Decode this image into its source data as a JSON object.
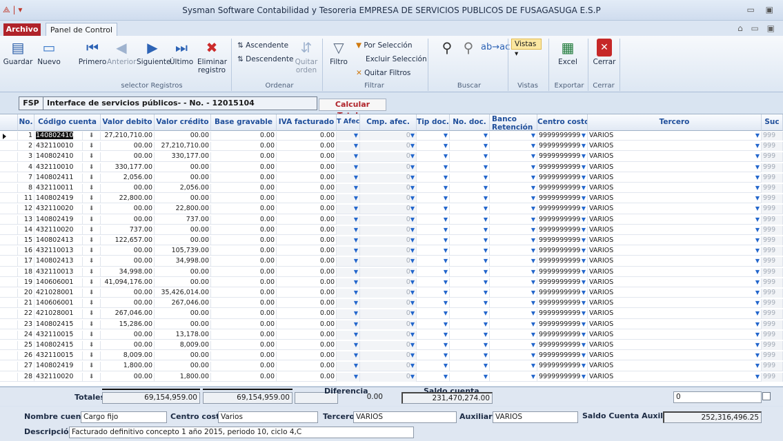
{
  "window": {
    "title": "Sysman Software Contabilidad y Tesoreria EMPRESA DE SERVICIOS PUBLICOS DE FUSAGASUGA E.S.P"
  },
  "tabs": {
    "archivo": "Archivo",
    "panel": "Panel de Control"
  },
  "ribbon": {
    "guardar": "Guardar",
    "nuevo": "Nuevo",
    "primero": "Primero",
    "anterior": "Anterior",
    "siguiente": "Siguiente",
    "ultimo": "Último",
    "eliminar": "Eliminar registro",
    "ascendente": "Ascendente",
    "descendente": "Descendente",
    "quitar_orden": "Quitar orden",
    "filtro": "Filtro",
    "por_seleccion": "Por Selección",
    "excluir_seleccion": "Excluir Selección",
    "quitar_filtros": "Quitar Filtros",
    "vistas": "Vistas",
    "excel": "Excel",
    "cerrar": "Cerrar",
    "groups": {
      "selector": "selector Registros",
      "ordenar": "Ordenar",
      "filtrar": "Filtrar",
      "buscar": "Buscar",
      "vistas": "Vistas",
      "exportar": "Exportar",
      "cerrar": "Cerrar"
    }
  },
  "record": {
    "code": "FSP",
    "description": "Interface de servicios públicos- - No. - 12015104",
    "calc_button": "Calcular Totales"
  },
  "columns": {
    "no": "No.",
    "codigo": "Código cuenta",
    "debito": "Valor debito",
    "credito": "Valor crédito",
    "base": "Base gravable",
    "iva": "IVA facturado",
    "tafec": "T Afec.",
    "cmp": "Cmp. afec.",
    "tipdoc": "Tip doc.",
    "nodoc": "No. doc.",
    "banco": "Banco Retención",
    "centro": "Centro costo",
    "tercero": "Tercero",
    "suc": "Suc"
  },
  "rows": [
    {
      "no": "1",
      "codigo": "140802410",
      "debito": "27,210,710.00",
      "credito": "00.00",
      "base": "0.00",
      "iva": "0.00",
      "cmp": "0",
      "centro": "9999999999",
      "tercero": "VARIOS",
      "suc": "999"
    },
    {
      "no": "2",
      "codigo": "432110010",
      "debito": "00.00",
      "credito": "27,210,710.00",
      "base": "0.00",
      "iva": "0.00",
      "cmp": "0",
      "centro": "9999999999",
      "tercero": "VARIOS",
      "suc": "999"
    },
    {
      "no": "3",
      "codigo": "140802410",
      "debito": "00.00",
      "credito": "330,177.00",
      "base": "0.00",
      "iva": "0.00",
      "cmp": "0",
      "centro": "9999999999",
      "tercero": "VARIOS",
      "suc": "999"
    },
    {
      "no": "4",
      "codigo": "432110010",
      "debito": "330,177.00",
      "credito": "00.00",
      "base": "0.00",
      "iva": "0.00",
      "cmp": "0",
      "centro": "9999999999",
      "tercero": "VARIOS",
      "suc": "999"
    },
    {
      "no": "7",
      "codigo": "140802411",
      "debito": "2,056.00",
      "credito": "00.00",
      "base": "0.00",
      "iva": "0.00",
      "cmp": "0",
      "centro": "9999999999",
      "tercero": "VARIOS",
      "suc": "999"
    },
    {
      "no": "8",
      "codigo": "432110011",
      "debito": "00.00",
      "credito": "2,056.00",
      "base": "0.00",
      "iva": "0.00",
      "cmp": "0",
      "centro": "9999999999",
      "tercero": "VARIOS",
      "suc": "999"
    },
    {
      "no": "11",
      "codigo": "140802419",
      "debito": "22,800.00",
      "credito": "00.00",
      "base": "0.00",
      "iva": "0.00",
      "cmp": "0",
      "centro": "9999999999",
      "tercero": "VARIOS",
      "suc": "999"
    },
    {
      "no": "12",
      "codigo": "432110020",
      "debito": "00.00",
      "credito": "22,800.00",
      "base": "0.00",
      "iva": "0.00",
      "cmp": "0",
      "centro": "9999999999",
      "tercero": "VARIOS",
      "suc": "999"
    },
    {
      "no": "13",
      "codigo": "140802419",
      "debito": "00.00",
      "credito": "737.00",
      "base": "0.00",
      "iva": "0.00",
      "cmp": "0",
      "centro": "9999999999",
      "tercero": "VARIOS",
      "suc": "999"
    },
    {
      "no": "14",
      "codigo": "432110020",
      "debito": "737.00",
      "credito": "00.00",
      "base": "0.00",
      "iva": "0.00",
      "cmp": "0",
      "centro": "9999999999",
      "tercero": "VARIOS",
      "suc": "999"
    },
    {
      "no": "15",
      "codigo": "140802413",
      "debito": "122,657.00",
      "credito": "00.00",
      "base": "0.00",
      "iva": "0.00",
      "cmp": "0",
      "centro": "9999999999",
      "tercero": "VARIOS",
      "suc": "999"
    },
    {
      "no": "16",
      "codigo": "432110013",
      "debito": "00.00",
      "credito": "105,739.00",
      "base": "0.00",
      "iva": "0.00",
      "cmp": "0",
      "centro": "9999999999",
      "tercero": "VARIOS",
      "suc": "999"
    },
    {
      "no": "17",
      "codigo": "140802413",
      "debito": "00.00",
      "credito": "34,998.00",
      "base": "0.00",
      "iva": "0.00",
      "cmp": "0",
      "centro": "9999999999",
      "tercero": "VARIOS",
      "suc": "999"
    },
    {
      "no": "18",
      "codigo": "432110013",
      "debito": "34,998.00",
      "credito": "00.00",
      "base": "0.00",
      "iva": "0.00",
      "cmp": "0",
      "centro": "9999999999",
      "tercero": "VARIOS",
      "suc": "999"
    },
    {
      "no": "19",
      "codigo": "140606001",
      "debito": "41,094,176.00",
      "credito": "00.00",
      "base": "0.00",
      "iva": "0.00",
      "cmp": "0",
      "centro": "9999999999",
      "tercero": "VARIOS",
      "suc": "999"
    },
    {
      "no": "20",
      "codigo": "421028001",
      "debito": "00.00",
      "credito": "35,426,014.00",
      "base": "0.00",
      "iva": "0.00",
      "cmp": "0",
      "centro": "9999999999",
      "tercero": "VARIOS",
      "suc": "999"
    },
    {
      "no": "21",
      "codigo": "140606001",
      "debito": "00.00",
      "credito": "267,046.00",
      "base": "0.00",
      "iva": "0.00",
      "cmp": "0",
      "centro": "9999999999",
      "tercero": "VARIOS",
      "suc": "999"
    },
    {
      "no": "22",
      "codigo": "421028001",
      "debito": "267,046.00",
      "credito": "00.00",
      "base": "0.00",
      "iva": "0.00",
      "cmp": "0",
      "centro": "9999999999",
      "tercero": "VARIOS",
      "suc": "999"
    },
    {
      "no": "23",
      "codigo": "140802415",
      "debito": "15,286.00",
      "credito": "00.00",
      "base": "0.00",
      "iva": "0.00",
      "cmp": "0",
      "centro": "9999999999",
      "tercero": "VARIOS",
      "suc": "999"
    },
    {
      "no": "24",
      "codigo": "432110015",
      "debito": "00.00",
      "credito": "13,178.00",
      "base": "0.00",
      "iva": "0.00",
      "cmp": "0",
      "centro": "9999999999",
      "tercero": "VARIOS",
      "suc": "999"
    },
    {
      "no": "25",
      "codigo": "140802415",
      "debito": "00.00",
      "credito": "8,009.00",
      "base": "0.00",
      "iva": "0.00",
      "cmp": "0",
      "centro": "9999999999",
      "tercero": "VARIOS",
      "suc": "999"
    },
    {
      "no": "26",
      "codigo": "432110015",
      "debito": "8,009.00",
      "credito": "00.00",
      "base": "0.00",
      "iva": "0.00",
      "cmp": "0",
      "centro": "9999999999",
      "tercero": "VARIOS",
      "suc": "999"
    },
    {
      "no": "27",
      "codigo": "140802419",
      "debito": "1,800.00",
      "credito": "00.00",
      "base": "0.00",
      "iva": "0.00",
      "cmp": "0",
      "centro": "9999999999",
      "tercero": "VARIOS",
      "suc": "999"
    },
    {
      "no": "28",
      "codigo": "432110020",
      "debito": "00.00",
      "credito": "1,800.00",
      "base": "0.00",
      "iva": "0.00",
      "cmp": "0",
      "centro": "9999999999",
      "tercero": "VARIOS",
      "suc": "999"
    }
  ],
  "totals": {
    "label": "Totales",
    "debito": "69,154,959.00",
    "credito": "69,154,959.00",
    "diferencia_label": "Diferencia",
    "diferencia": "0.00",
    "saldo_label": "Saldo cuenta",
    "saldo": "231,470,274.00",
    "input_value": "0"
  },
  "info": {
    "nombre_label": "Nombre cuenta",
    "nombre": "Cargo fijo",
    "centro_label": "Centro costo",
    "centro": "Varios",
    "tercero_label": "Tercero",
    "tercero": "VARIOS",
    "auxiliar_label": "Auxiliar",
    "auxiliar": "VARIOS",
    "saldo_aux_label": "Saldo Cuenta Auxiliar",
    "saldo_aux": "252,316,496.25",
    "descripcion_label": "Descripción:",
    "descripcion": "Facturado definitivo  concepto 1 año 2015, periodo 10, ciclo 4,C"
  }
}
